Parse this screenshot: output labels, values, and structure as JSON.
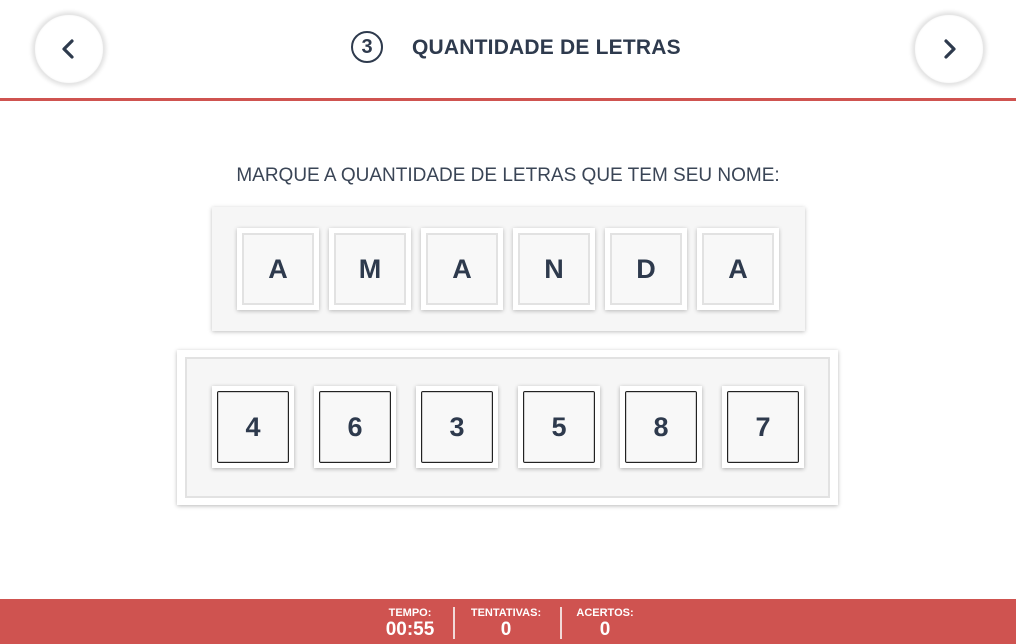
{
  "header": {
    "step_number": "3",
    "title": "QUANTIDADE DE LETRAS"
  },
  "instruction": "MARQUE A QUANTIDADE DE LETRAS QUE TEM SEU NOME:",
  "name_letters": [
    "A",
    "M",
    "A",
    "N",
    "D",
    "A"
  ],
  "number_options": [
    "4",
    "6",
    "3",
    "5",
    "8",
    "7"
  ],
  "footer": {
    "time_label": "TEMPO:",
    "time_value": "00:55",
    "attempts_label": "TENTATIVAS:",
    "attempts_value": "0",
    "hits_label": "ACERTOS:",
    "hits_value": "0"
  },
  "colors": {
    "accent": "#cf5350",
    "text": "#2e3a4d"
  },
  "icons": {
    "prev": "chevron-left-icon",
    "next": "chevron-right-icon"
  }
}
